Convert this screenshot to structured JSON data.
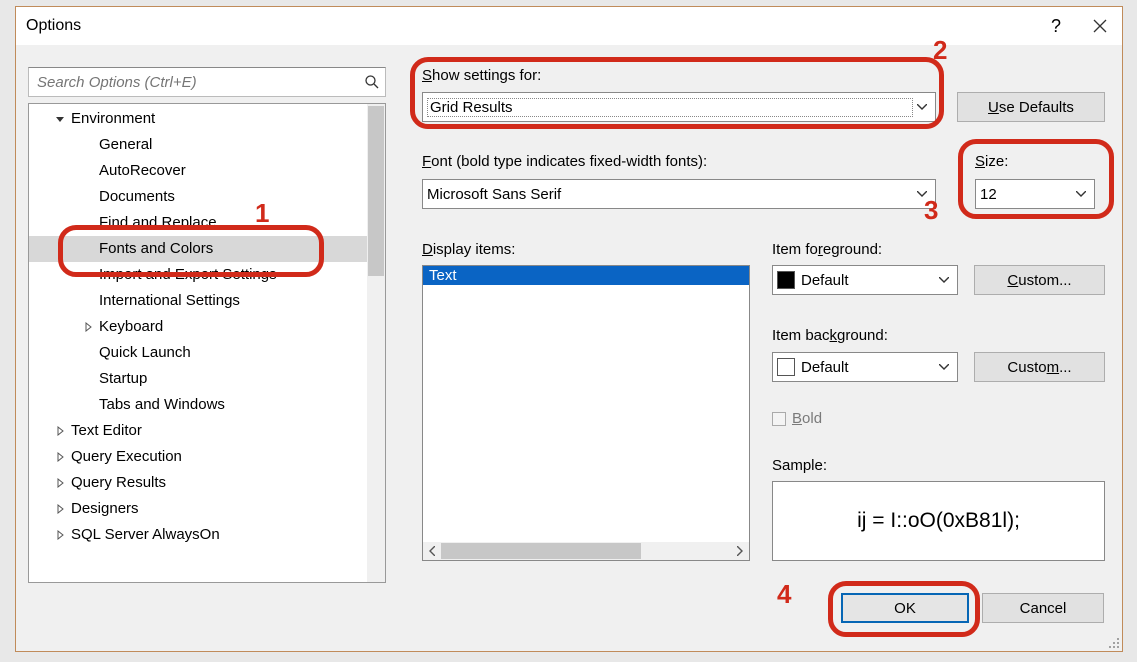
{
  "window": {
    "title": "Options"
  },
  "search": {
    "placeholder": "Search Options (Ctrl+E)"
  },
  "tree": [
    {
      "level": 0,
      "glyph": "expanded",
      "label": "Environment",
      "selected": false
    },
    {
      "level": 1,
      "glyph": "none",
      "label": "General"
    },
    {
      "level": 1,
      "glyph": "none",
      "label": "AutoRecover"
    },
    {
      "level": 1,
      "glyph": "none",
      "label": "Documents"
    },
    {
      "level": 1,
      "glyph": "none",
      "label": "Find and Replace"
    },
    {
      "level": 1,
      "glyph": "none",
      "label": "Fonts and Colors",
      "selected": true
    },
    {
      "level": 1,
      "glyph": "none",
      "label": "Import and Export Settings"
    },
    {
      "level": 1,
      "glyph": "none",
      "label": "International Settings"
    },
    {
      "level": 1,
      "glyph": "collapsed",
      "label": "Keyboard"
    },
    {
      "level": 1,
      "glyph": "none",
      "label": "Quick Launch"
    },
    {
      "level": 1,
      "glyph": "none",
      "label": "Startup"
    },
    {
      "level": 1,
      "glyph": "none",
      "label": "Tabs and Windows"
    },
    {
      "level": 0,
      "glyph": "collapsed",
      "label": "Text Editor"
    },
    {
      "level": 0,
      "glyph": "collapsed",
      "label": "Query Execution"
    },
    {
      "level": 0,
      "glyph": "collapsed",
      "label": "Query Results"
    },
    {
      "level": 0,
      "glyph": "collapsed",
      "label": "Designers"
    },
    {
      "level": 0,
      "glyph": "collapsed",
      "label": "SQL Server AlwaysOn"
    }
  ],
  "labels": {
    "show_settings_for": "Show settings for:",
    "font": "Font (bold type indicates fixed-width fonts):",
    "size": "Size:",
    "display_items": "Display items:",
    "item_foreground": "Item foreground:",
    "item_background": "Item background:",
    "bold": "Bold",
    "sample": "Sample:"
  },
  "values": {
    "show_settings_for": "Grid Results",
    "font": "Microsoft Sans Serif",
    "size": "12",
    "item_foreground": "Default",
    "item_background": "Default",
    "sample_text": "ij = I::oO(0xB81l);"
  },
  "display_items": [
    {
      "label": "Text",
      "selected": true
    }
  ],
  "buttons": {
    "use_defaults": "Use Defaults",
    "custom_fg": "Custom...",
    "custom_bg": "Custom...",
    "ok": "OK",
    "cancel": "Cancel"
  },
  "annotations": {
    "n1": "1",
    "n2": "2",
    "n3": "3",
    "n4": "4"
  }
}
